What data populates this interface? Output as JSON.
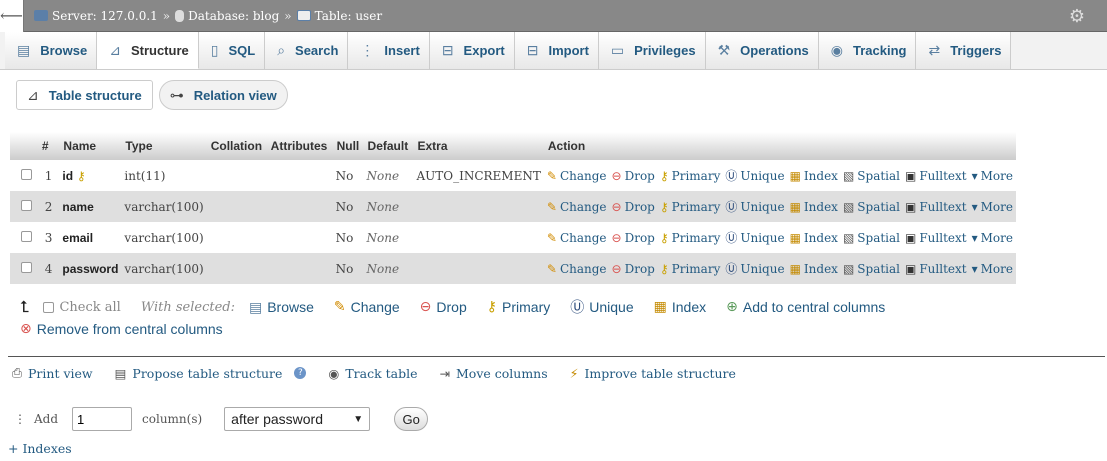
{
  "breadcrumb": {
    "server": "Server: 127.0.0.1",
    "database": "Database: blog",
    "table": "Table: user",
    "separator": "»"
  },
  "tabs": [
    {
      "label": "Browse",
      "icon": "browse-icon",
      "glyph": "▤"
    },
    {
      "label": "Structure",
      "icon": "structure-icon",
      "glyph": "⊿",
      "active": true
    },
    {
      "label": "SQL",
      "icon": "sql-icon",
      "glyph": "▯"
    },
    {
      "label": "Search",
      "icon": "search-icon",
      "glyph": "⌕"
    },
    {
      "label": "Insert",
      "icon": "insert-icon",
      "glyph": "⋮"
    },
    {
      "label": "Export",
      "icon": "export-icon",
      "glyph": "⊟"
    },
    {
      "label": "Import",
      "icon": "import-icon",
      "glyph": "⊟"
    },
    {
      "label": "Privileges",
      "icon": "privileges-icon",
      "glyph": "▭"
    },
    {
      "label": "Operations",
      "icon": "operations-icon",
      "glyph": "⚒"
    },
    {
      "label": "Tracking",
      "icon": "tracking-icon",
      "glyph": "◉"
    },
    {
      "label": "Triggers",
      "icon": "triggers-icon",
      "glyph": "⇄"
    }
  ],
  "subtabs": {
    "table_structure": "Table structure",
    "relation_view": "Relation view"
  },
  "columns": [
    "#",
    "Name",
    "Type",
    "Collation",
    "Attributes",
    "Null",
    "Default",
    "Extra",
    "Action"
  ],
  "rows": [
    {
      "num": "1",
      "name": "id",
      "primary_key": true,
      "type": "int(11)",
      "collation": "",
      "attributes": "",
      "null": "No",
      "default": "None",
      "extra": "AUTO_INCREMENT"
    },
    {
      "num": "2",
      "name": "name",
      "primary_key": false,
      "type": "varchar(100)",
      "collation": "",
      "attributes": "",
      "null": "No",
      "default": "None",
      "extra": ""
    },
    {
      "num": "3",
      "name": "email",
      "primary_key": false,
      "type": "varchar(100)",
      "collation": "",
      "attributes": "",
      "null": "No",
      "default": "None",
      "extra": ""
    },
    {
      "num": "4",
      "name": "password",
      "primary_key": false,
      "type": "varchar(100)",
      "collation": "",
      "attributes": "",
      "null": "No",
      "default": "None",
      "extra": ""
    }
  ],
  "row_actions": {
    "change": "Change",
    "drop": "Drop",
    "primary": "Primary",
    "unique": "Unique",
    "index": "Index",
    "spatial": "Spatial",
    "fulltext": "Fulltext",
    "more": "More"
  },
  "bulk": {
    "check_all": "Check all",
    "with_selected": "With selected:",
    "browse": "Browse",
    "change": "Change",
    "drop": "Drop",
    "primary": "Primary",
    "unique": "Unique",
    "index": "Index",
    "add_central": "Add to central columns",
    "remove_central": "Remove from central columns"
  },
  "tools": {
    "print_view": "Print view",
    "propose": "Propose table structure",
    "track": "Track table",
    "move_columns": "Move columns",
    "improve": "Improve table structure"
  },
  "add_columns": {
    "label": "Add",
    "count": "1",
    "suffix": "column(s)",
    "position": "after password",
    "go": "Go"
  },
  "indexes_link": "+ Indexes",
  "colors": {
    "topbar": "#888888",
    "link": "#235a81",
    "row_alt": "#dfdfdf"
  }
}
